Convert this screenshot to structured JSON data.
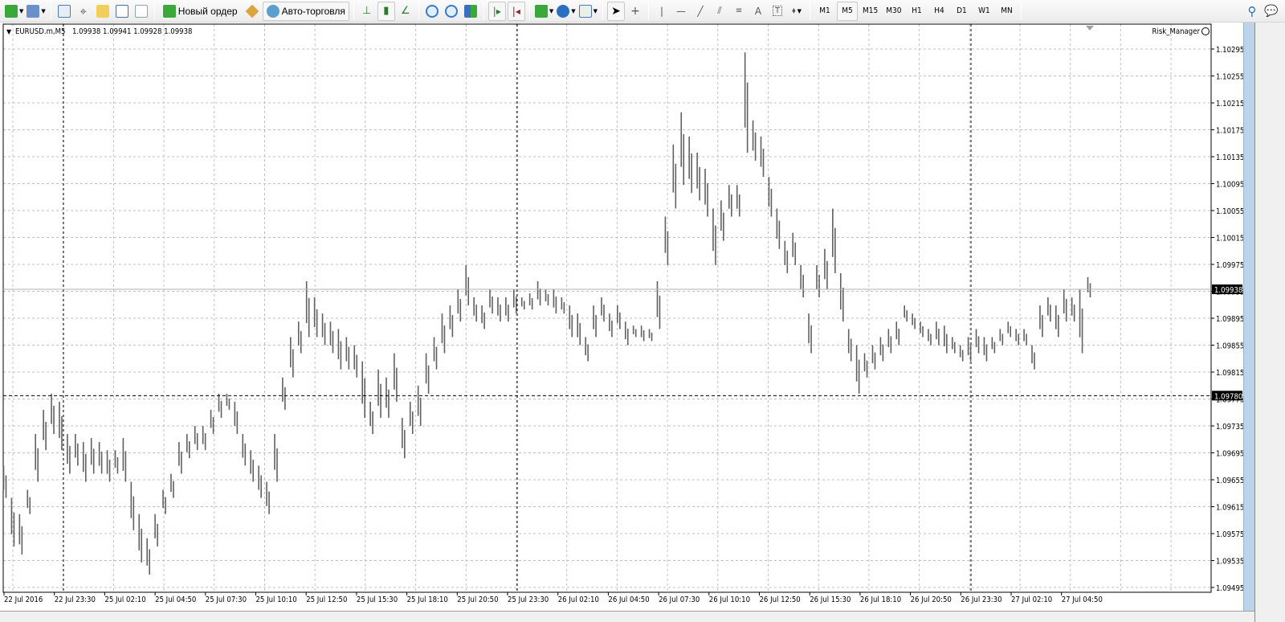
{
  "toolbar": {
    "new_order_label": "Новый ордер",
    "autotrading_label": "Авто-торговля",
    "timeframes": [
      "M1",
      "M5",
      "M15",
      "M30",
      "H1",
      "H4",
      "D1",
      "W1",
      "MN"
    ],
    "selected_timeframe": "M5",
    "icons": [
      "new-chart-icon",
      "profiles-icon",
      "market-watch-icon",
      "data-window-icon",
      "navigator-icon",
      "terminal-icon",
      "strategy-tester-icon",
      "new-order-icon",
      "metaeditor-icon",
      "autotrading-icon",
      "bar-chart-icon",
      "candlestick-icon",
      "line-chart-icon",
      "zoom-in-icon",
      "zoom-out-icon",
      "tile-windows-icon",
      "auto-scroll-icon",
      "chart-shift-icon",
      "indicators-icon",
      "periods-icon",
      "templates-icon",
      "cursor-icon",
      "crosshair-icon",
      "vertical-line-icon",
      "horizontal-line-icon",
      "trendline-icon",
      "equidistant-channel-icon",
      "fibonacci-icon",
      "text-icon",
      "text-label-icon",
      "arrows-icon",
      "search-icon",
      "chat-icon"
    ]
  },
  "chart": {
    "symbol_info": "EURUSD.m,M5",
    "ohlc": "1.09938 1.09941 1.09928 1.09938",
    "expert_label": "Risk_Manager",
    "expert_icon": "smiley-icon",
    "bid_price": "1.09938",
    "hline_price": "1.09780",
    "colors": {
      "bars": "#606060",
      "grid": "#c0c0c0",
      "background": "#ffffff",
      "price_label_bg": "#000000"
    }
  },
  "chart_data": {
    "type": "bar",
    "symbol": "EURUSD.m",
    "timeframe": "M5",
    "ylim": [
      1.09495,
      1.10295
    ],
    "grid": true,
    "y_ticks": [
      "1.10295",
      "1.10255",
      "1.10215",
      "1.10175",
      "1.10135",
      "1.10095",
      "1.10055",
      "1.10015",
      "1.09975",
      "1.09935",
      "1.09895",
      "1.09855",
      "1.09815",
      "1.09775",
      "1.09735",
      "1.09695",
      "1.09655",
      "1.09615",
      "1.09575",
      "1.09535",
      "1.09495"
    ],
    "x_ticks": [
      "22 Jul 2016",
      "22 Jul 23:30",
      "25 Jul 02:10",
      "25 Jul 04:50",
      "25 Jul 07:30",
      "25 Jul 10:10",
      "25 Jul 12:50",
      "25 Jul 15:30",
      "25 Jul 18:10",
      "25 Jul 20:50",
      "25 Jul 23:30",
      "26 Jul 02:10",
      "26 Jul 04:50",
      "26 Jul 07:30",
      "26 Jul 10:10",
      "26 Jul 12:50",
      "26 Jul 15:30",
      "26 Jul 18:10",
      "26 Jul 20:50",
      "26 Jul 23:30",
      "27 Jul 02:10",
      "27 Jul 04:50"
    ],
    "high_low": [
      [
        1.09676,
        1.09628
      ],
      [
        1.09628,
        1.09556
      ],
      [
        1.09604,
        1.09544
      ],
      [
        1.0964,
        1.09604
      ],
      [
        1.09723,
        1.09652
      ],
      [
        1.09759,
        1.09699
      ],
      [
        1.09783,
        1.09723
      ],
      [
        1.09771,
        1.09699
      ],
      [
        1.09723,
        1.09664
      ],
      [
        1.09723,
        1.09676
      ],
      [
        1.09711,
        1.09652
      ],
      [
        1.09717,
        1.09664
      ],
      [
        1.09711,
        1.09664
      ],
      [
        1.09699,
        1.09652
      ],
      [
        1.09699,
        1.09664
      ],
      [
        1.09717,
        1.09652
      ],
      [
        1.09652,
        1.0958
      ],
      [
        1.09604,
        1.09532
      ],
      [
        1.09568,
        1.09514
      ],
      [
        1.09604,
        1.09556
      ],
      [
        1.0964,
        1.09604
      ],
      [
        1.09664,
        1.09628
      ],
      [
        1.09711,
        1.09664
      ],
      [
        1.09723,
        1.09687
      ],
      [
        1.09735,
        1.09699
      ],
      [
        1.09735,
        1.09699
      ],
      [
        1.09759,
        1.09723
      ],
      [
        1.09783,
        1.09747
      ],
      [
        1.09783,
        1.09759
      ],
      [
        1.09771,
        1.09723
      ],
      [
        1.09723,
        1.09676
      ],
      [
        1.09699,
        1.09652
      ],
      [
        1.09676,
        1.09628
      ],
      [
        1.09652,
        1.09604
      ],
      [
        1.09723,
        1.09652
      ],
      [
        1.09807,
        1.09759
      ],
      [
        1.09867,
        1.09807
      ],
      [
        1.0989,
        1.09843
      ],
      [
        1.0995,
        1.09867
      ],
      [
        1.09926,
        1.09867
      ],
      [
        1.09902,
        1.09855
      ],
      [
        1.0989,
        1.09843
      ],
      [
        1.09879,
        1.09819
      ],
      [
        1.09867,
        1.09819
      ],
      [
        1.09855,
        1.09807
      ],
      [
        1.09831,
        1.09747
      ],
      [
        1.09771,
        1.09723
      ],
      [
        1.09819,
        1.09747
      ],
      [
        1.09807,
        1.09747
      ],
      [
        1.09843,
        1.09771
      ],
      [
        1.09747,
        1.09687
      ],
      [
        1.09771,
        1.09723
      ],
      [
        1.09795,
        1.09735
      ],
      [
        1.09843,
        1.09783
      ],
      [
        1.09867,
        1.09819
      ],
      [
        1.09902,
        1.09843
      ],
      [
        1.09914,
        1.09867
      ],
      [
        1.09938,
        1.0989
      ],
      [
        1.09974,
        1.09914
      ],
      [
        1.09926,
        1.0989
      ],
      [
        1.09914,
        1.09879
      ],
      [
        1.09938,
        1.09902
      ],
      [
        1.09926,
        1.0989
      ],
      [
        1.09926,
        1.0989
      ],
      [
        1.09938,
        1.09902
      ],
      [
        1.09926,
        1.09908
      ],
      [
        1.09932,
        1.09908
      ],
      [
        1.0995,
        1.09914
      ],
      [
        1.09938,
        1.09914
      ],
      [
        1.09938,
        1.09902
      ],
      [
        1.09926,
        1.09902
      ],
      [
        1.09914,
        1.09867
      ],
      [
        1.09902,
        1.09855
      ],
      [
        1.09867,
        1.09831
      ],
      [
        1.09914,
        1.09867
      ],
      [
        1.09926,
        1.0989
      ],
      [
        1.09902,
        1.09867
      ],
      [
        1.09914,
        1.09879
      ],
      [
        1.0989,
        1.09855
      ],
      [
        1.09884,
        1.09867
      ],
      [
        1.09884,
        1.09861
      ],
      [
        1.09879,
        1.09861
      ],
      [
        1.0995,
        1.09879
      ],
      [
        1.10046,
        1.09974
      ],
      [
        1.10153,
        1.10058
      ],
      [
        1.10201,
        1.10093
      ],
      [
        1.10165,
        1.10081
      ],
      [
        1.10141,
        1.1007
      ],
      [
        1.10117,
        1.10046
      ],
      [
        1.10058,
        1.09974
      ],
      [
        1.1007,
        1.1001
      ],
      [
        1.10093,
        1.10046
      ],
      [
        1.10093,
        1.10046
      ],
      [
        1.1029,
        1.10141
      ],
      [
        1.10189,
        1.10129
      ],
      [
        1.10165,
        1.10105
      ],
      [
        1.10105,
        1.10046
      ],
      [
        1.10058,
        1.09998
      ],
      [
        1.1001,
        1.09962
      ],
      [
        1.10022,
        1.09974
      ],
      [
        1.09974,
        1.09926
      ],
      [
        1.09902,
        1.09843
      ],
      [
        1.09974,
        1.09926
      ],
      [
        1.09998,
        1.09938
      ],
      [
        1.10058,
        1.09962
      ],
      [
        1.09962,
        1.0989
      ],
      [
        1.09879,
        1.09831
      ],
      [
        1.09855,
        1.09783
      ],
      [
        1.09843,
        1.09807
      ],
      [
        1.09855,
        1.09819
      ],
      [
        1.09867,
        1.09831
      ],
      [
        1.09879,
        1.09843
      ],
      [
        1.0989,
        1.09855
      ],
      [
        1.09914,
        1.0989
      ],
      [
        1.09902,
        1.09879
      ],
      [
        1.0989,
        1.09867
      ],
      [
        1.09879,
        1.09855
      ],
      [
        1.0989,
        1.09855
      ],
      [
        1.09884,
        1.09843
      ],
      [
        1.09867,
        1.09843
      ],
      [
        1.09855,
        1.09831
      ],
      [
        1.09867,
        1.09831
      ],
      [
        1.09879,
        1.09843
      ],
      [
        1.09867,
        1.09831
      ],
      [
        1.09867,
        1.09843
      ],
      [
        1.09879,
        1.09855
      ],
      [
        1.0989,
        1.09867
      ],
      [
        1.09879,
        1.09855
      ],
      [
        1.09879,
        1.09855
      ],
      [
        1.09855,
        1.09819
      ],
      [
        1.09914,
        1.09867
      ],
      [
        1.09926,
        1.0989
      ],
      [
        1.09914,
        1.09867
      ],
      [
        1.09938,
        1.0989
      ],
      [
        1.09926,
        1.0989
      ],
      [
        1.09938,
        1.09843
      ],
      [
        1.09956,
        1.09926
      ]
    ]
  }
}
